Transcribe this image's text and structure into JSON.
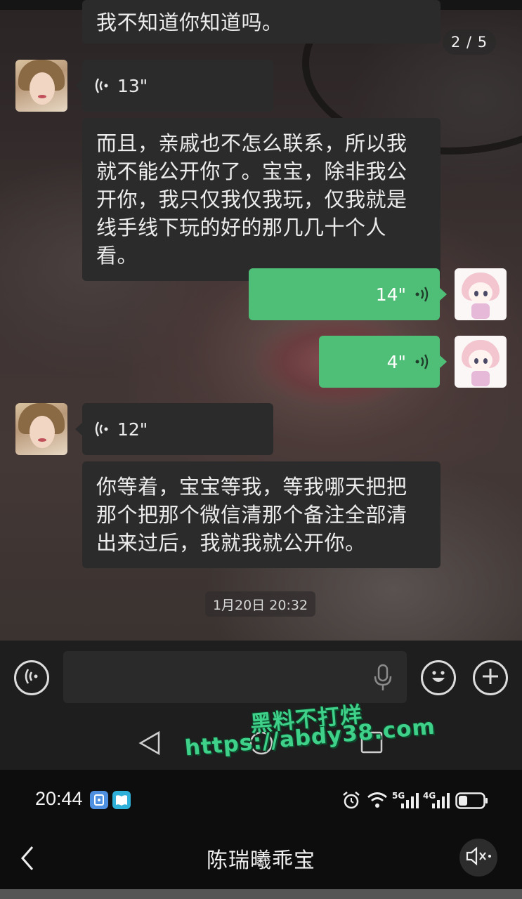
{
  "photo_page_indicator": "2 / 5",
  "messages": [
    {
      "side": "in",
      "type": "text",
      "text": "我不知道你知道吗。"
    },
    {
      "side": "in",
      "type": "voice",
      "duration": "13\""
    },
    {
      "side": "in",
      "type": "text",
      "lines": [
        "而且，亲戚也不怎么联系，所以我",
        "就不能公开你了。宝宝，除非我公",
        "开你，我只仅我仅我玩，仅我就是",
        "线手线下玩的好的那几几十个人看。"
      ]
    },
    {
      "side": "out",
      "type": "voice",
      "duration": "14\""
    },
    {
      "side": "out",
      "type": "voice",
      "duration": "4\""
    },
    {
      "side": "in",
      "type": "voice",
      "duration": "12\""
    },
    {
      "side": "in",
      "type": "text",
      "lines": [
        "你等着，宝宝等我，等我哪天把把",
        "那个把那个微信清那个备注全部清",
        "出来过后，我就我就公开你。"
      ]
    }
  ],
  "timestamp": "1月20日 20:32",
  "input": {
    "value": ""
  },
  "watermark": {
    "line1": "黑料不打烊",
    "line2": "https://abdy38.com"
  },
  "status_bar": {
    "time": "20:44",
    "network_5g": "5G",
    "network_4g": "4G"
  },
  "header": {
    "title": "陈瑞曦乖宝"
  },
  "colors": {
    "outgoing_bubble": "#4fbf77",
    "incoming_bubble": "#2b2b2b",
    "watermark": "#3fd18a"
  },
  "icons": [
    "voice-input-icon",
    "microphone-icon",
    "emoji-icon",
    "plus-icon",
    "nav-back-triangle-icon",
    "nav-home-circle-icon",
    "nav-recents-square-icon",
    "alarm-icon",
    "wifi-icon",
    "signal-icon",
    "battery-icon",
    "back-chevron-icon",
    "mute-icon"
  ]
}
